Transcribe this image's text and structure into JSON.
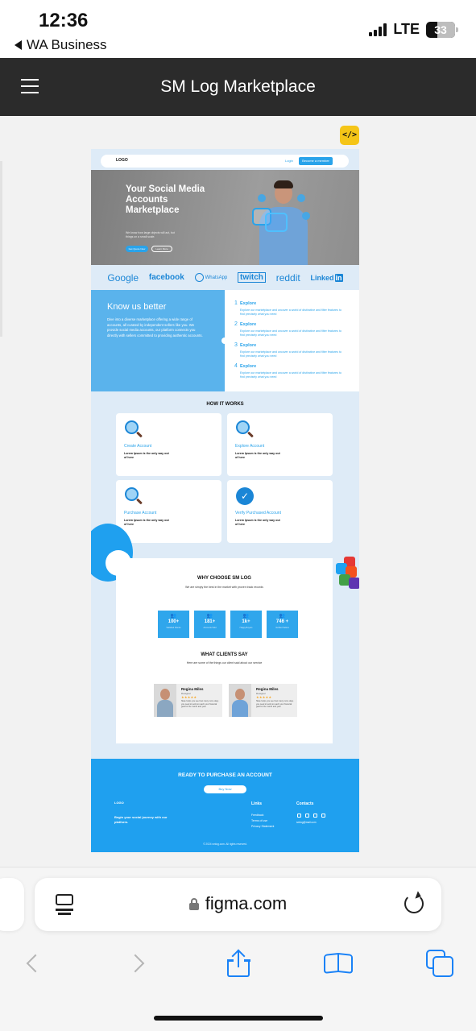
{
  "status_bar": {
    "time": "12:36",
    "back_app": "WA Business",
    "network": "LTE",
    "battery": "33"
  },
  "app_header": {
    "title": "SM Log Marketplace"
  },
  "design": {
    "code_badge": "</>",
    "nav": {
      "logo": "LOGO",
      "login": "Login",
      "cta": "Become a member"
    },
    "hero": {
      "title": "Your Social Media Accounts Marketplace",
      "subtitle": "We know how large objects will act, but things on a small scale.",
      "primary_button": "Get Quote Now",
      "secondary_button": "Learn More"
    },
    "brands": [
      "Google",
      "facebook",
      "WhatsApp",
      "twitch",
      "reddit",
      "Linked"
    ],
    "brand_linkedin_suffix": "in",
    "know_us": {
      "title": "Know us better",
      "description": "Dive into a diverse marketplace offering a wide range of accounts, all curated by independent sellers like you. We provide social media accounts, our platform connects you directly with sellers committed to providing authentic accounts.",
      "items": [
        {
          "num": "1",
          "title": "Explore",
          "text": "Explore our marketplace and uncover a world of distinctive and filter features to find precisely what you need"
        },
        {
          "num": "2",
          "title": "Explore",
          "text": "Explore our marketplace and uncover a world of distinctive and filter features to find precisely what you need"
        },
        {
          "num": "3",
          "title": "Explore",
          "text": "Explore our marketplace and uncover a world of distinctive and filter features to find precisely what you need"
        },
        {
          "num": "4",
          "title": "Explore",
          "text": "Explore our marketplace and uncover a world of distinctive and filter features to find precisely what you need"
        }
      ]
    },
    "how_it_works": {
      "title": "HOW IT WORKS",
      "cards": [
        {
          "title": "Create Account",
          "text": "Lorem Ipsum is the only way out of here"
        },
        {
          "title": "Explore Account",
          "text": "Lorem Ipsum is the only way out of here"
        },
        {
          "title": "Purchase Account",
          "text": "Lorem Ipsum is the only way out of here"
        },
        {
          "title": "Verify Purchased Account",
          "text": "Lorem Ipsum is the only way out of here"
        }
      ]
    },
    "why_choose": {
      "title": "WHY CHOOSE SM LOG",
      "subtitle": "We are simply the best in the market with proven track records",
      "stats": [
        {
          "value": "100+",
          "label": "Satisfied Clients"
        },
        {
          "value": "181+",
          "label": "Accounts Sold"
        },
        {
          "value": "1k+",
          "label": "Happy Buyers"
        },
        {
          "value": "746 +",
          "label": "Verified Sellers"
        }
      ]
    },
    "clients": {
      "title": "WHAT CLIENTS SAY",
      "subtitle": "Here are some of the things our client said about our service",
      "testimonials": [
        {
          "name": "Regina Miles",
          "role": "Designer",
          "stars": "★★★★★",
          "text": "Slate helps you see how many more days you need to work to reach your financial goal for the month and year."
        },
        {
          "name": "Regina Miles",
          "role": "Designer",
          "stars": "★★★★★",
          "text": "Slate helps you see how many more days you need to work to reach your financial goal for the month and year."
        }
      ]
    },
    "footer": {
      "cta_title": "READY TO PURCHASE AN ACCOUNT",
      "cta_button": "Buy Now",
      "logo": "LOGO",
      "tagline": "Begin your social journey with our platform.",
      "links_title": "Links",
      "links": [
        "Feedback",
        "Terms of use",
        "Privacy Statement"
      ],
      "contacts_title": "Contacts",
      "email": "smlog@mail.com",
      "copyright": "© 2024 smlog.com. All rights reserved."
    }
  },
  "browser": {
    "url": "figma.com"
  },
  "colors": {
    "accent": "#1fa0ef",
    "header_bg": "#2b2b2b",
    "safari_blue": "#1a82f7"
  }
}
